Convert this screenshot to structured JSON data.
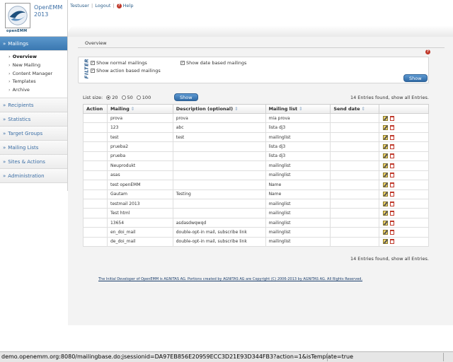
{
  "app": {
    "name_line1": "OpenEMM",
    "name_line2": "2013",
    "logo_text": "openEMM",
    "user": "Testuser",
    "logout": "Logout",
    "help": "Help"
  },
  "sidebar": {
    "mailings": "Mailings",
    "sub": [
      "Overview",
      "New Mailing",
      "Content Manager",
      "Templates",
      "Archive"
    ],
    "recipients": "Recipients",
    "statistics": "Statistics",
    "target_groups": "Target Groups",
    "mailing_lists": "Mailing Lists",
    "sites_actions": "Sites & Actions",
    "administration": "Administration"
  },
  "content": {
    "tab": "Overview",
    "filter_label": "FILTER",
    "filter": {
      "normal": "Show normal mailings",
      "date": "Show date based mailings",
      "action": "Show action based mailings",
      "show_button": "Show"
    },
    "list_size_label": "List size:",
    "sizes": [
      "20",
      "50",
      "100"
    ],
    "selected_size": "20",
    "show_button": "Show",
    "entries_text": "14 Entries found, show all Entries."
  },
  "table": {
    "headers": [
      "Action",
      "Mailing",
      "Description (optional)",
      "Mailing list",
      "Send date"
    ],
    "rows": [
      {
        "mailing": "prova",
        "description": "prova",
        "list": "mia prova"
      },
      {
        "mailing": "123",
        "description": "abc",
        "list": "lista dj3"
      },
      {
        "mailing": "test",
        "description": "test",
        "list": "mailinglist"
      },
      {
        "mailing": "prueba2",
        "description": "",
        "list": "lista dj3"
      },
      {
        "mailing": "prueba",
        "description": "",
        "list": "lista dj3"
      },
      {
        "mailing": "Neuprodukt",
        "description": "",
        "list": "mailinglist"
      },
      {
        "mailing": "asas",
        "description": "",
        "list": "mailinglist"
      },
      {
        "mailing": "test openEMM",
        "description": "",
        "list": "Name"
      },
      {
        "mailing": "Gautam",
        "description": "Testing",
        "list": "Name"
      },
      {
        "mailing": "testmail 2013",
        "description": "",
        "list": "mailinglist"
      },
      {
        "mailing": "Test html",
        "description": "",
        "list": "mailinglist"
      },
      {
        "mailing": "13654",
        "description": "asdasdwqwqd",
        "list": "mailinglist"
      },
      {
        "mailing": "en_doi_mail",
        "description": "double-opt-in mail, subscribe link",
        "list": "mailinglist"
      },
      {
        "mailing": "de_doi_mail",
        "description": "double-opt-in mail, subscribe link",
        "list": "mailinglist"
      }
    ]
  },
  "footer": "The Initial Developer of OpenEMM is AGNITAS AG. Portions created by AGNITAS AG are Copyright (C) 2006-2013 by AGNITAS AG. All Rights Reserved.",
  "status_bar": "demo.openemm.org:8080/mailingbase.do;jsessionid=DA97EB856E20959ECC3D21E93D344FB3?action=1&isTemplate=true",
  "icons": {
    "edit": "edit-icon",
    "delete": "delete-icon",
    "help": "help-icon"
  }
}
